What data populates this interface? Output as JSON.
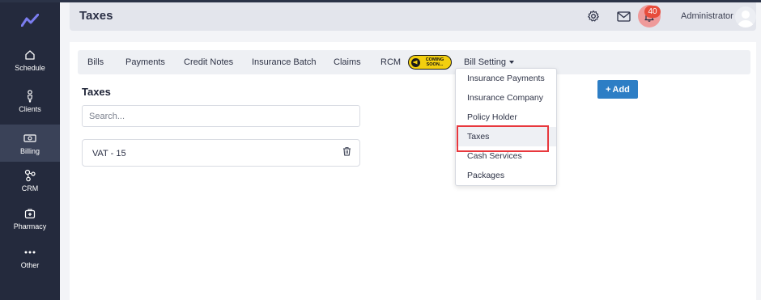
{
  "sidebar": {
    "logo": "chart-logo",
    "items": [
      {
        "label": "Schedule",
        "icon": "home-icon"
      },
      {
        "label": "Clients",
        "icon": "person-icon"
      },
      {
        "label": "Billing",
        "icon": "money-icon",
        "active": true
      },
      {
        "label": "CRM",
        "icon": "network-icon"
      },
      {
        "label": "Pharmacy",
        "icon": "medkit-icon"
      },
      {
        "label": "Other",
        "icon": "more-icon"
      }
    ]
  },
  "header": {
    "title": "Taxes",
    "notification_count": "40",
    "user": "Administrator"
  },
  "tabs": [
    {
      "label": "Bills"
    },
    {
      "label": "Payments"
    },
    {
      "label": "Credit Notes"
    },
    {
      "label": "Insurance Batch"
    },
    {
      "label": "Claims"
    },
    {
      "label": "RCM"
    },
    {
      "label": "Bill Setting"
    }
  ],
  "coming_soon_badge": "COMING SOON...",
  "content": {
    "section_title": "Taxes",
    "search_placeholder": "Search...",
    "taxes": [
      {
        "label": "VAT - 15"
      }
    ],
    "add_button": "Add"
  },
  "dropdown": {
    "items": [
      {
        "label": "Insurance Payments"
      },
      {
        "label": "Insurance Company"
      },
      {
        "label": "Policy Holder"
      },
      {
        "label": "Taxes",
        "active": true
      },
      {
        "label": "Cash Services"
      },
      {
        "label": "Packages"
      }
    ]
  },
  "colors": {
    "sidebar": "#242a3d",
    "accent": "#2d7ec5",
    "highlight": "#e8383d",
    "badge": "#e74c3c"
  }
}
